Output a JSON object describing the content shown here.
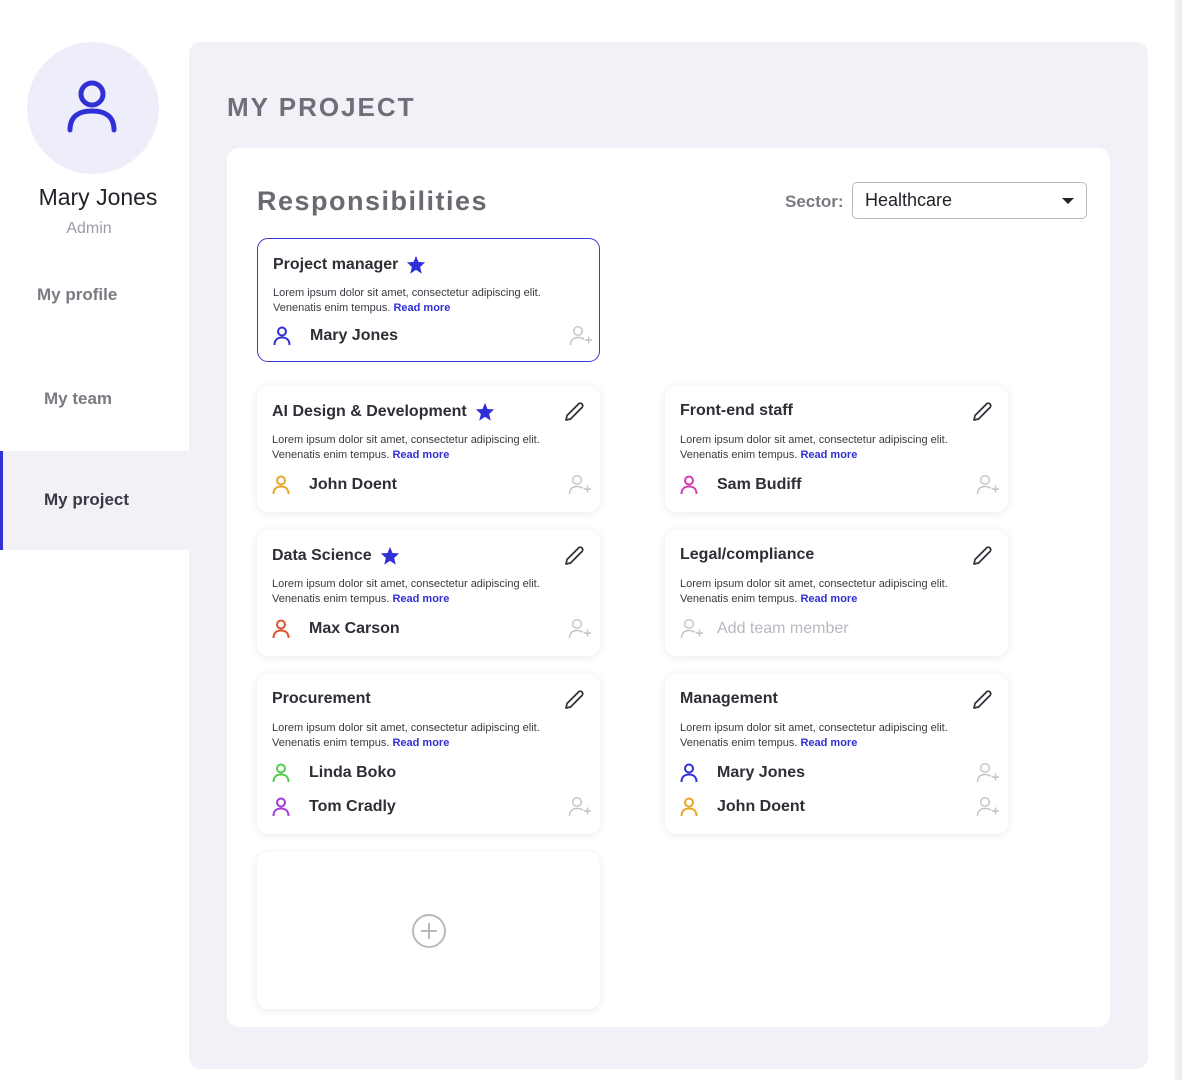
{
  "user": {
    "name": "Mary Jones",
    "role": "Admin"
  },
  "nav": {
    "items": [
      {
        "label": "My profile"
      },
      {
        "label": "My team"
      },
      {
        "label": "My project"
      }
    ]
  },
  "page": {
    "title": "MY PROJECT"
  },
  "panel": {
    "title": "Responsibilities",
    "sector_label": "Sector:",
    "sector_value": "Healthcare"
  },
  "description": "Lorem ipsum dolor sit amet, consectetur adipiscing elit. Venenatis enim tempus.",
  "read_more": "Read more",
  "cards": [
    {
      "title": "Project manager",
      "members": [
        {
          "name": "Mary Jones",
          "color": "#3030d6"
        }
      ]
    },
    {
      "title": "AI Design & Development",
      "members": [
        {
          "name": "John Doent",
          "color": "#e8a526"
        }
      ]
    },
    {
      "title": "Front-end staff",
      "members": [
        {
          "name": "Sam Budiff",
          "color": "#d63bb0"
        }
      ]
    },
    {
      "title": "Data Science",
      "members": [
        {
          "name": "Max Carson",
          "color": "#e0522c"
        }
      ]
    },
    {
      "title": "Legal/compliance",
      "add_label": "Add team member"
    },
    {
      "title": "Procurement",
      "members": [
        {
          "name": "Linda Boko",
          "color": "#52cc4a"
        },
        {
          "name": "Tom Cradly",
          "color": "#a43ad8"
        }
      ]
    },
    {
      "title": "Management",
      "members": [
        {
          "name": "Mary Jones",
          "color": "#3030d6"
        },
        {
          "name": "John Doent",
          "color": "#e8a526"
        }
      ]
    }
  ],
  "colors": {
    "accent": "#3030d6",
    "muted": "#b8b8c0"
  }
}
